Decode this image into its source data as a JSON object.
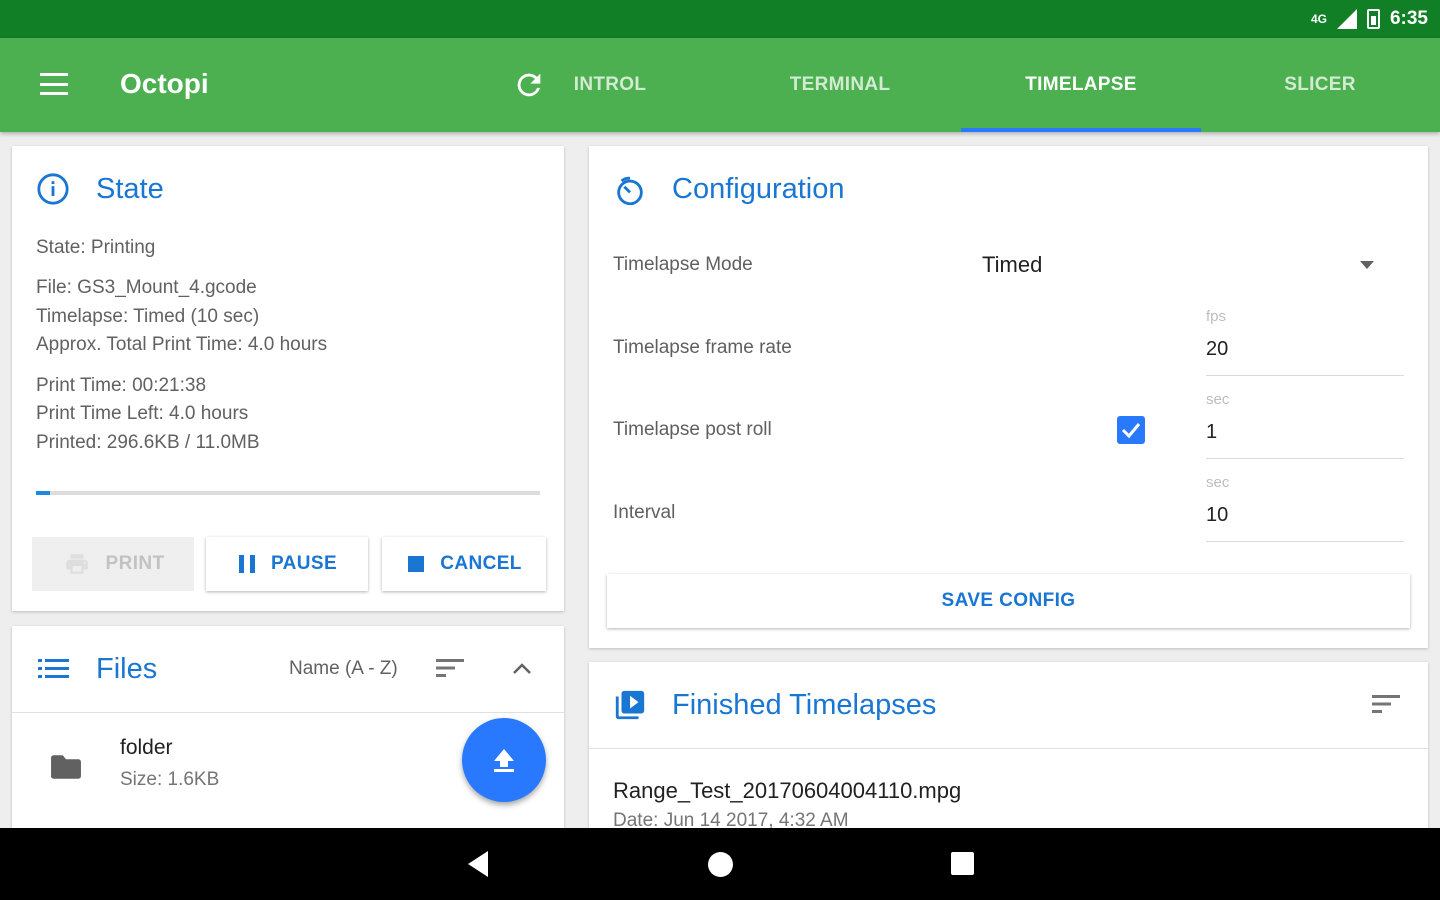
{
  "status_bar": {
    "signal": "4G",
    "time": "6:35"
  },
  "app_bar": {
    "title": "Octopi"
  },
  "tabs": [
    {
      "label": "INTROL",
      "active": false
    },
    {
      "label": "TERMINAL",
      "active": false
    },
    {
      "label": "TIMELAPSE",
      "active": true
    },
    {
      "label": "SLICER",
      "active": false
    }
  ],
  "state_card": {
    "title": "State",
    "state": "State: Printing",
    "file": "File: GS3_Mount_4.gcode",
    "timelapse": "Timelapse: Timed (10 sec)",
    "approx_time": "Approx. Total Print Time: 4.0 hours",
    "print_time": "Print Time: 00:21:38",
    "print_time_left": "Print Time Left: 4.0 hours",
    "printed": "Printed: 296.6KB / 11.0MB",
    "progress_fraction": 0.027,
    "buttons": {
      "print": "PRINT",
      "pause": "PAUSE",
      "cancel": "CANCEL"
    }
  },
  "files_card": {
    "title": "Files",
    "sort_label": "Name (A - Z)",
    "items": [
      {
        "name": "folder",
        "size": "Size: 1.6KB"
      }
    ]
  },
  "config_card": {
    "title": "Configuration",
    "mode_label": "Timelapse Mode",
    "mode_value": "Timed",
    "frame_rate_label": "Timelapse frame rate",
    "frame_rate_unit": "fps",
    "frame_rate_value": "20",
    "post_roll_label": "Timelapse post roll",
    "post_roll_checked": true,
    "post_roll_unit": "sec",
    "post_roll_value": "1",
    "interval_label": "Interval",
    "interval_unit": "sec",
    "interval_value": "10",
    "save_button": "SAVE CONFIG"
  },
  "finished_card": {
    "title": "Finished Timelapses",
    "items": [
      {
        "name": "Range_Test_20170604004110.mpg",
        "date": "Date: Jun 14 2017, 4:32 AM"
      }
    ]
  },
  "colors": {
    "status_bar": "#107f25",
    "app_bar": "#4caf50",
    "accent": "#2979ff",
    "title_blue": "#1976d2"
  }
}
